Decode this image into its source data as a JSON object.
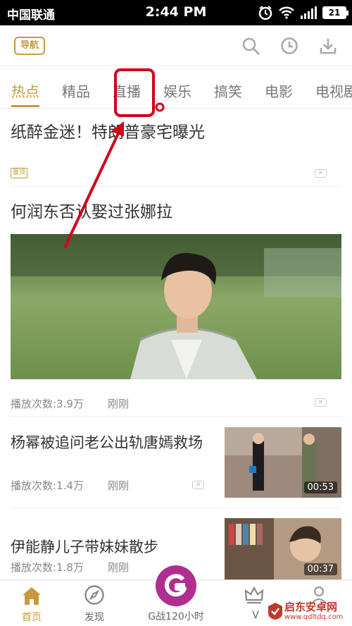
{
  "status_bar": {
    "carrier": "中国联通",
    "time": "2:44 PM",
    "battery": "21"
  },
  "app_bar": {
    "nav_badge": "导航",
    "icons": [
      "search-icon",
      "history-icon",
      "download-icon"
    ]
  },
  "tabs": [
    {
      "label": "热点",
      "active": true
    },
    {
      "label": "精品",
      "active": false
    },
    {
      "label": "直播",
      "active": false
    },
    {
      "label": "娱乐",
      "active": false
    },
    {
      "label": "搞笑",
      "active": false
    },
    {
      "label": "电影",
      "active": false
    },
    {
      "label": "电视剧",
      "active": false
    }
  ],
  "feed": {
    "headline1": "纸醉金迷！特朗普豪宅曝光",
    "pinned_tag": "置顶",
    "headline2": "何润东否认娶过张娜拉",
    "hero_meta": {
      "plays": "播放次数:3.9万",
      "time": "刚刚"
    },
    "items": [
      {
        "title": "杨幂被追问老公出轨唐嫣救场",
        "plays": "播放次数:1.4万",
        "time": "刚刚",
        "duration": "00:53"
      },
      {
        "title": "伊能静儿子带妹妹散步",
        "plays": "播放次数:1.8万",
        "time": "刚刚",
        "duration": "00:37"
      }
    ]
  },
  "bottom_nav": {
    "home": "首页",
    "discover": "发现",
    "center": "G战120小时",
    "vip": "V"
  },
  "watermark": {
    "line1": "启东安卓网",
    "line2": "www.qdltdq.com"
  },
  "colors": {
    "accent": "#c79a3e",
    "annotation": "#d0021b",
    "center_button": "#b02e8f"
  }
}
